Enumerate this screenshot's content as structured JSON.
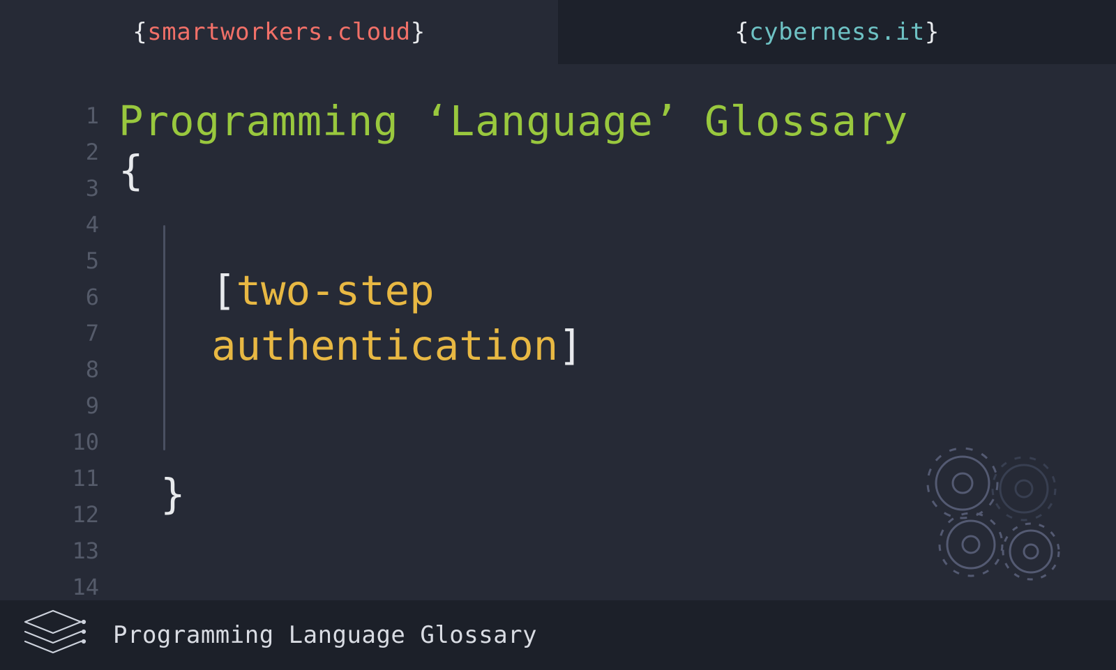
{
  "tabs": {
    "left": {
      "brace_open": "{",
      "name": "smartworkers.cloud",
      "brace_close": "}"
    },
    "right": {
      "brace_open": "{",
      "name": "cyberness.it",
      "brace_close": "}"
    }
  },
  "editor": {
    "line_count": 14,
    "title": "Programming ‘Language’ Glossary",
    "open_brace": "{",
    "close_brace": "}",
    "term_bracket_open": "[",
    "term_line1": "two-step",
    "term_line2": "authentication",
    "term_bracket_close": "]"
  },
  "footer": {
    "label": "Programming Language Glossary"
  },
  "icons": {
    "stack": "stack-icon",
    "gears": "gears-icon"
  },
  "colors": {
    "background": "#262a36",
    "tab_inactive": "#1d212b",
    "footer_bg": "#1c2029",
    "title_green": "#99c83e",
    "site_left": "#f17068",
    "site_right": "#6ec2c4",
    "term_yellow": "#e8b843",
    "brace_white": "#e8eaed",
    "gutter_text": "#555b6a"
  }
}
